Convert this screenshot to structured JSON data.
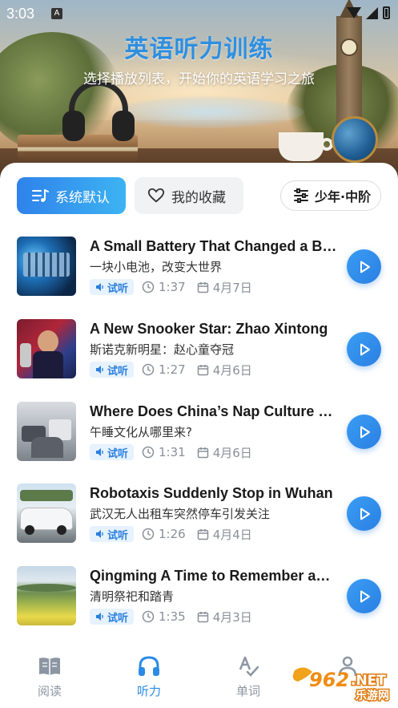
{
  "status_bar": {
    "time": "3:03",
    "app_icon": "A"
  },
  "hero": {
    "title": "英语听力训练",
    "subtitle": "选择播放列表，开始你的英语学习之旅"
  },
  "tabs": {
    "default_label": "系统默认",
    "favorites_label": "我的收藏",
    "filter_label": "少年·中阶"
  },
  "list": [
    {
      "title": "A Small Battery That Changed a Bigger World",
      "subtitle": "一块小电池，改变大世界",
      "badge": "试听",
      "duration": "1:37",
      "date": "4月7日"
    },
    {
      "title": " A New Snooker Star: Zhao Xintong",
      "subtitle": "斯诺克新明星：赵心童夺冠",
      "badge": "试听",
      "duration": "1:27",
      "date": "4月6日"
    },
    {
      "title": "Where Does China’s Nap Culture Come From",
      "subtitle": "午睡文化从哪里来?",
      "badge": "试听",
      "duration": "1:31",
      "date": "4月6日"
    },
    {
      "title": "Robotaxis Suddenly Stop in Wuhan",
      "subtitle": "武汉无人出租车突然停车引发关注",
      "badge": "试听",
      "duration": "1:26",
      "date": "4月4日"
    },
    {
      "title": "Qingming A Time to Remember and Reflect",
      "subtitle": "清明祭祀和踏青",
      "badge": "试听",
      "duration": "1:35",
      "date": "4月3日"
    }
  ],
  "nav": {
    "read": "阅读",
    "listen": "听力",
    "words": "单词"
  },
  "watermark": {
    "brand": "962.NET",
    "sub": "乐游网"
  },
  "colors": {
    "accent": "#2b8be6",
    "badge_bg": "#e6f2fd"
  }
}
